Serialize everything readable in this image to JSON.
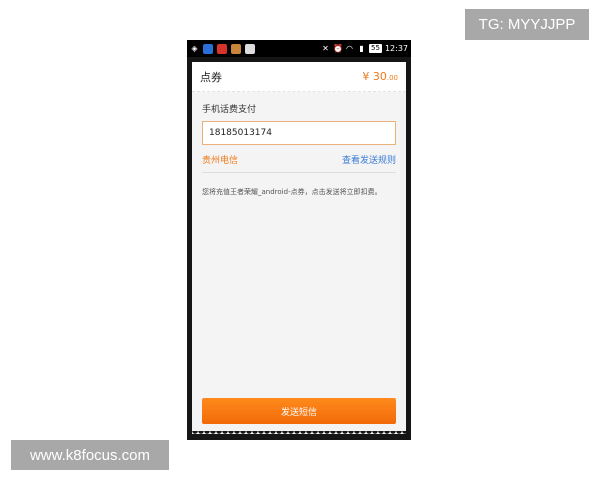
{
  "watermarks": {
    "top_right": "TG: MYYJJPP",
    "bottom_left": "www.k8focus.com"
  },
  "statusbar": {
    "time": "12:37",
    "battery": "55",
    "icons": [
      "location-icon",
      "app-icon-1",
      "app-icon-2",
      "app-icon-3",
      "app-icon-4",
      "mute-icon",
      "alarm-icon",
      "wifi-icon",
      "signal-icon"
    ]
  },
  "sheet": {
    "title": "点券",
    "price_main": "¥ 30",
    "price_decimal": ".00",
    "section_label": "手机话费支付",
    "phone_number": "18185013174",
    "carrier": "贵州电信",
    "rules_link": "查看发送规则",
    "notice": "您将充值王者荣耀_android-点券，点击发送将立即扣费。",
    "send_button": "发送短信"
  },
  "colors": {
    "accent": "#f07a1a",
    "link": "#3a7bd5",
    "button": "#f57a12"
  }
}
